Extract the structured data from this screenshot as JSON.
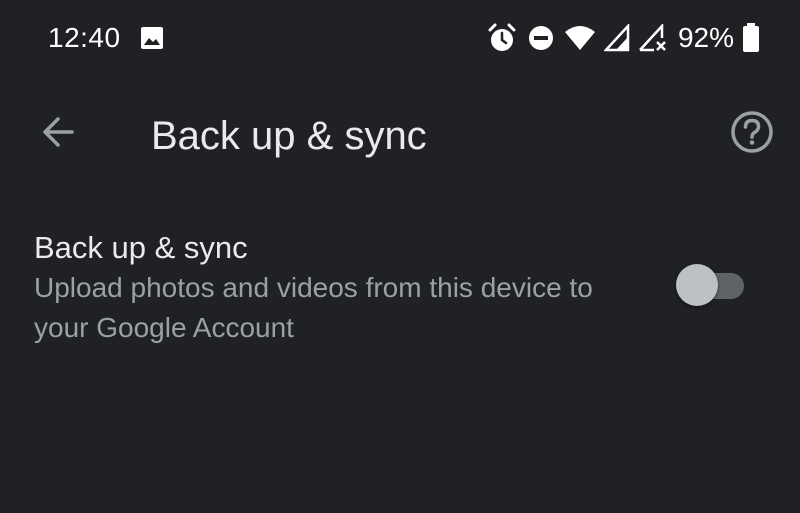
{
  "status_bar": {
    "time": "12:40",
    "battery_percent": "92%",
    "icons": [
      "image-icon",
      "alarm-icon",
      "do-not-disturb-icon",
      "wifi-icon",
      "cell-signal-icon",
      "cell-signal-no-data-icon",
      "battery-icon"
    ]
  },
  "app_bar": {
    "title": "Back up & sync",
    "back_icon": "arrow-back-icon",
    "help_icon": "help-circle-icon"
  },
  "setting": {
    "title": "Back up & sync",
    "description": "Upload photos and videos from this device to your Google Account",
    "toggle_on": false
  },
  "colors": {
    "background": "#202124",
    "primary_text": "#e8eaed",
    "secondary_text": "#9aa0a6",
    "toggle_track": "#5f6368",
    "toggle_thumb": "#bdc1c6"
  }
}
